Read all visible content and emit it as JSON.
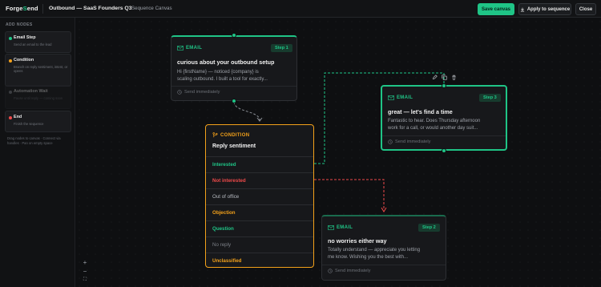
{
  "app": {
    "logo_prefix": "Forge",
    "logo_accent": "S",
    "logo_suffix": "end",
    "title": "Outbound — SaaS Founders Q3",
    "breadcrumb_sep": "/",
    "subtitle": "Sequence Canvas"
  },
  "toolbar": {
    "save_label": "Save canvas",
    "apply_label": "Apply to sequence",
    "close_label": "Close"
  },
  "sidebar": {
    "heading": "ADD NODES",
    "items": [
      {
        "name": "Email Step",
        "desc": "Send an email to the lead",
        "color": "#1fc486",
        "disabled": false
      },
      {
        "name": "Condition",
        "desc": "Branch on reply sentiment, intent, or opens",
        "color": "#f3a11a",
        "disabled": false
      },
      {
        "name": "Automation Wait",
        "desc": "Pause until reply — coming soon",
        "color": "#8a8f96",
        "disabled": true
      },
      {
        "name": "End",
        "desc": "Finish the sequence",
        "color": "#f04a4a",
        "disabled": false
      }
    ],
    "hint": "Drag nodes to canvas · Connect via handles · Pan on empty space"
  },
  "canvas": {
    "step1": {
      "type_label": "EMAIL",
      "badge": "Step 1",
      "title": "curious about your outbound setup",
      "body_line1": "Hi {firstName} — noticed {company} is",
      "body_line2": "scaling outbound. I built a tool for exactly...",
      "footer": "Send immediately"
    },
    "step3": {
      "type_label": "EMAIL",
      "badge": "Step 3",
      "title": "great — let's find a time",
      "body_line1": "Fantastic to hear. Does Thursday afternoon",
      "body_line2": "work for a call, or would another day suit...",
      "footer": "Send immediately"
    },
    "step2": {
      "type_label": "EMAIL",
      "badge": "Step 2",
      "title": "no worries either way",
      "body_line1": "Totally understand — appreciate you letting",
      "body_line2": "me know. Wishing you the best with...",
      "footer": "Send immediately"
    },
    "condition": {
      "type_label": "CONDITION",
      "title": "Reply sentiment",
      "branches": [
        {
          "label": "Interested",
          "color": "#1fc486"
        },
        {
          "label": "Not interested",
          "color": "#f04a4a"
        },
        {
          "label": "Out of office",
          "color": "#b5b9bf"
        },
        {
          "label": "Objection",
          "color": "#f3a11a"
        },
        {
          "label": "Question",
          "color": "#1fc486"
        },
        {
          "label": "No reply",
          "color": "#7d8188"
        },
        {
          "label": "Unclassified",
          "color": "#f3a11a"
        }
      ]
    },
    "zoom_controls": [
      "+",
      "−",
      "⛶"
    ]
  },
  "colors": {
    "accent": "#1fc486",
    "condition": "#f3a11a",
    "danger": "#f04a4a",
    "background": "#0e0f11"
  },
  "icons": {
    "apply": "download-icon",
    "email": "mail-icon",
    "condition": "branch-icon",
    "footer": "clock-icon",
    "tools": [
      "pencil-icon",
      "copy-icon",
      "trash-icon"
    ]
  }
}
